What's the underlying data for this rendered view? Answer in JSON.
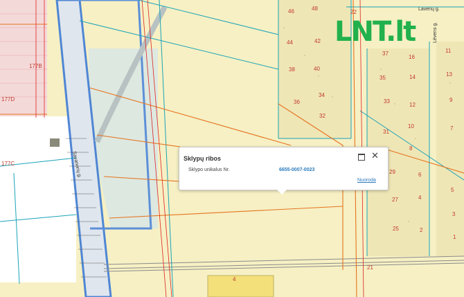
{
  "logo": {
    "text": "LNT.lt"
  },
  "popup": {
    "title": "Sklypų ribos",
    "label": "Sklypo unikalus Nr.",
    "value": "6655-0007-0023",
    "link": "Nuoroda",
    "maximize_icon": "maximize-icon",
    "close_icon": "close-icon",
    "close_symbol": "✕"
  },
  "streets": [
    "Lavenų g.",
    "Savanorių g.",
    "Lėvens g."
  ],
  "plot_numbers": [
    "46",
    "48",
    "44",
    "42",
    "38",
    "40",
    "36",
    "34",
    "32",
    "22",
    "37",
    "16",
    "35",
    "14",
    "33",
    "12",
    "31",
    "10",
    "8",
    "29",
    "6",
    "27",
    "4",
    "25",
    "2",
    "11",
    "13",
    "9",
    "7",
    "5",
    "3",
    "1",
    "177В",
    "177D",
    "177C",
    "21",
    "4"
  ],
  "colors": {
    "parcel_fill": "#f6f0c4",
    "road_blue": "#4f86d4",
    "rail": "#9a9a9a",
    "parcel_line_orange": "#e6731f",
    "zone_line_cyan": "#1aa3b8",
    "plot_number_red": "#c0392b",
    "popup_link": "#2b7bbd",
    "logo_green": "#22b14c"
  }
}
